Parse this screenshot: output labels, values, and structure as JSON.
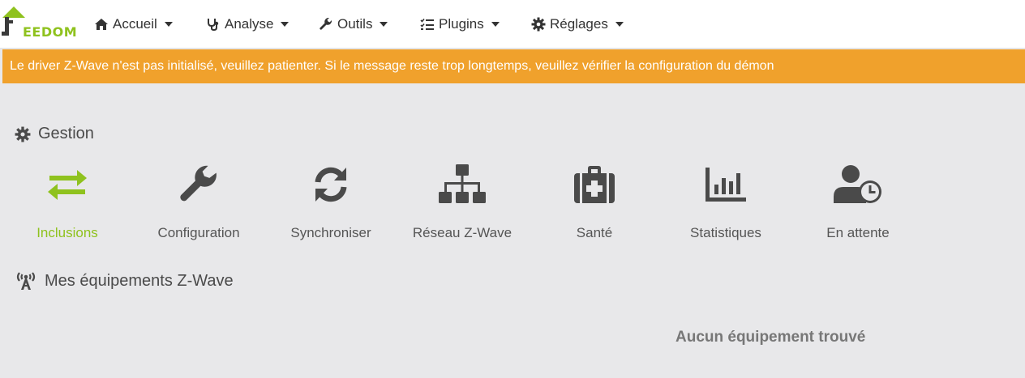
{
  "brand": {
    "logo_text_first": "J",
    "logo_text_rest": "EEDOM",
    "accent": "#8fc21e"
  },
  "navbar": {
    "items": [
      {
        "label": "Accueil",
        "icon": "home-icon"
      },
      {
        "label": "Analyse",
        "icon": "stethoscope-icon"
      },
      {
        "label": "Outils",
        "icon": "wrench-icon"
      },
      {
        "label": "Plugins",
        "icon": "tasks-icon"
      },
      {
        "label": "Réglages",
        "icon": "gear-icon"
      }
    ]
  },
  "alert": {
    "text": "Le driver Z-Wave n'est pas initialisé, veuillez patienter. Si le message reste trop longtemps, veuillez vérifier la configuration du démon",
    "color": "#f0a12c"
  },
  "gestion": {
    "title": "Gestion",
    "tiles": [
      {
        "label": "Inclusions",
        "icon": "exchange-arrows-icon",
        "active": true
      },
      {
        "label": "Configuration",
        "icon": "wrench-icon"
      },
      {
        "label": "Synchroniser",
        "icon": "sync-icon"
      },
      {
        "label": "Réseau Z-Wave",
        "icon": "network-icon"
      },
      {
        "label": "Santé",
        "icon": "medkit-icon"
      },
      {
        "label": "Statistiques",
        "icon": "bar-chart-icon"
      },
      {
        "label": "En attente",
        "icon": "user-clock-icon"
      }
    ]
  },
  "equipments": {
    "title": "Mes équipements Z-Wave",
    "empty_message": "Aucun équipement trouvé"
  }
}
